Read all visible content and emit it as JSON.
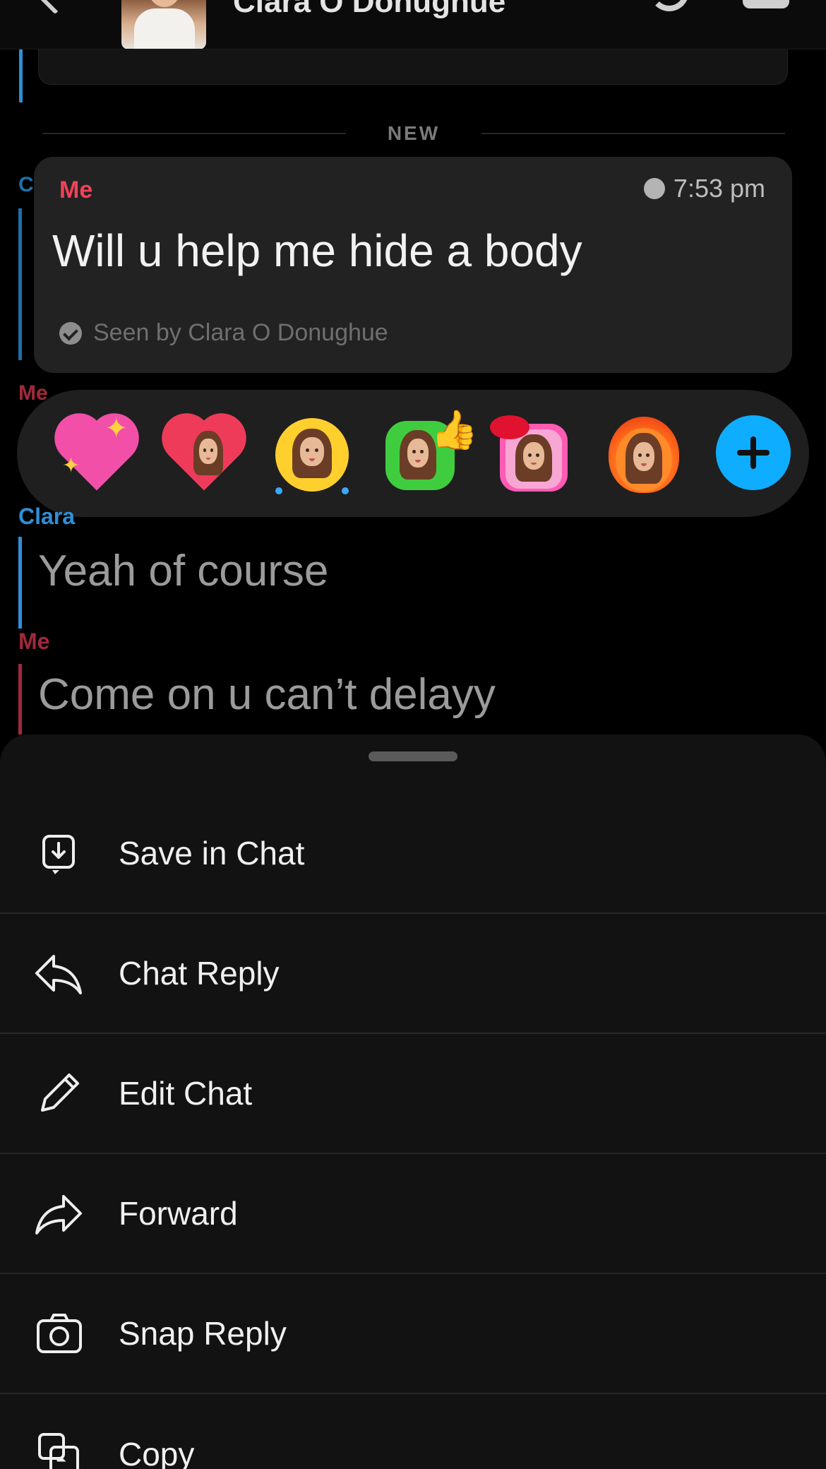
{
  "header": {
    "contact_name": "Clara O Donughue"
  },
  "chat": {
    "divider_label": "NEW",
    "side_labels": {
      "clara_initial": "C",
      "me_partial": "Me"
    },
    "highlighted_message": {
      "sender": "Me",
      "time": "7:53 pm",
      "text": "Will u help me hide a body",
      "seen_text": "Seen by Clara O Donughue"
    },
    "messages": [
      {
        "sender": "Clara",
        "text": "Yeah of course"
      },
      {
        "sender": "Me",
        "text": "Come on u can’t delayy"
      }
    ]
  },
  "reactions": [
    {
      "icon": "sparkling-heart-icon"
    },
    {
      "icon": "bitmoji-heart-icon"
    },
    {
      "icon": "bitmoji-laugh-cry-icon"
    },
    {
      "icon": "bitmoji-thumbs-up-icon"
    },
    {
      "icon": "bitmoji-kiss-icon"
    },
    {
      "icon": "bitmoji-fire-icon"
    },
    {
      "icon": "add-reaction-icon"
    }
  ],
  "menu": {
    "items": [
      {
        "label": "Save in Chat",
        "icon": "save-download-icon"
      },
      {
        "label": "Chat Reply",
        "icon": "reply-arrow-icon"
      },
      {
        "label": "Edit Chat",
        "icon": "pencil-icon"
      },
      {
        "label": "Forward",
        "icon": "forward-arrow-icon"
      },
      {
        "label": "Snap Reply",
        "icon": "camera-icon"
      },
      {
        "label": "Copy",
        "icon": "copy-icon"
      }
    ]
  },
  "colors": {
    "me_accent": "#f2425a",
    "clara_accent": "#2f8fd6",
    "add_button": "#0fadff",
    "sheet_bg": "#121212"
  }
}
